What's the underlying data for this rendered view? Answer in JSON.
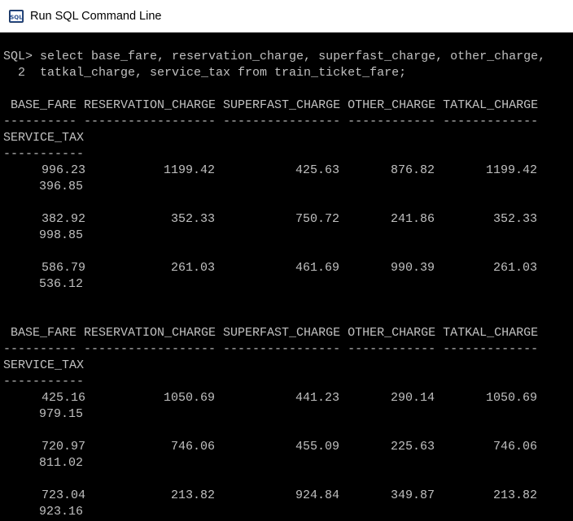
{
  "window": {
    "title": "Run SQL Command Line",
    "icon": "sql-console-icon"
  },
  "colors": {
    "console_bg": "#000000",
    "console_text": "#c0c0c0",
    "titlebar_bg": "#ffffff"
  },
  "console": {
    "prompt_line_1": "SQL> select base_fare, reservation_charge, superfast_charge, other_charge,",
    "prompt_line_2": "  2  tatkal_charge, service_tax from train_ticket_fare;",
    "header_line": " BASE_FARE RESERVATION_CHARGE SUPERFAST_CHARGE OTHER_CHARGE TATKAL_CHARGE",
    "header_rule": "---------- ------------------ ---------------- ------------ -------------",
    "wrap_header": "SERVICE_TAX",
    "wrap_rule": "-----------",
    "columns": [
      "BASE_FARE",
      "RESERVATION_CHARGE",
      "SUPERFAST_CHARGE",
      "OTHER_CHARGE",
      "TATKAL_CHARGE",
      "SERVICE_TAX"
    ],
    "pages": [
      {
        "rows": [
          {
            "base_fare": "996.23",
            "reservation_charge": "1199.42",
            "superfast_charge": "425.63",
            "other_charge": "876.82",
            "tatkal_charge": "1199.42",
            "service_tax": "396.85"
          },
          {
            "base_fare": "382.92",
            "reservation_charge": "352.33",
            "superfast_charge": "750.72",
            "other_charge": "241.86",
            "tatkal_charge": "352.33",
            "service_tax": "998.85"
          },
          {
            "base_fare": "586.79",
            "reservation_charge": "261.03",
            "superfast_charge": "461.69",
            "other_charge": "990.39",
            "tatkal_charge": "261.03",
            "service_tax": "536.12"
          }
        ]
      },
      {
        "rows": [
          {
            "base_fare": "425.16",
            "reservation_charge": "1050.69",
            "superfast_charge": "441.23",
            "other_charge": "290.14",
            "tatkal_charge": "1050.69",
            "service_tax": "979.15"
          },
          {
            "base_fare": "720.97",
            "reservation_charge": "746.06",
            "superfast_charge": "455.09",
            "other_charge": "225.63",
            "tatkal_charge": "746.06",
            "service_tax": "811.02"
          },
          {
            "base_fare": "723.04",
            "reservation_charge": "213.82",
            "superfast_charge": "924.84",
            "other_charge": "349.87",
            "tatkal_charge": "213.82",
            "service_tax": "923.16"
          }
        ]
      }
    ]
  }
}
